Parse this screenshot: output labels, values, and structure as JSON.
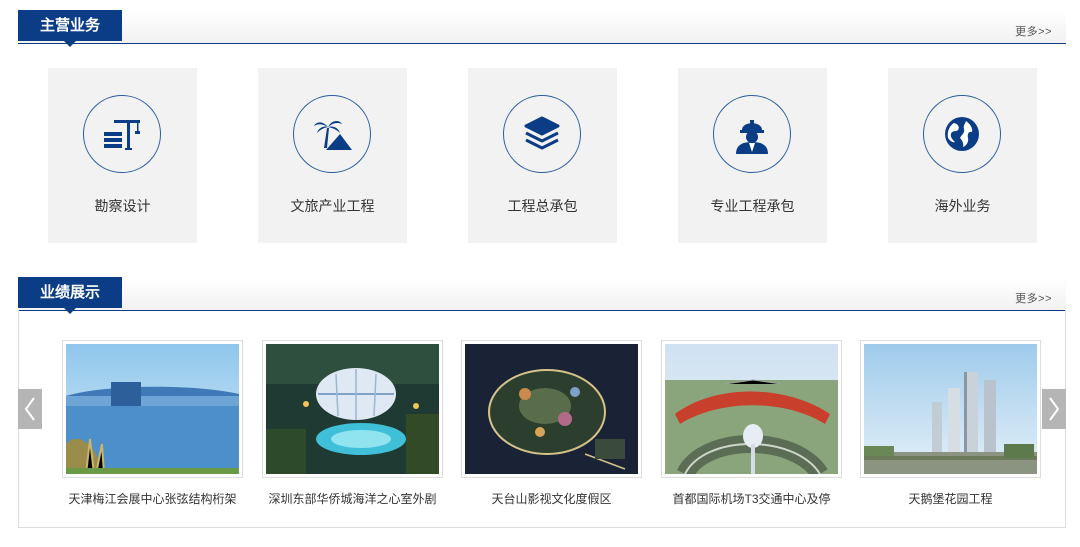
{
  "sections": {
    "services": {
      "title": "主营业务",
      "more": "更多>>"
    },
    "works": {
      "title": "业绩展示",
      "more": "更多>>"
    }
  },
  "services": [
    {
      "label": "勘察设计",
      "icon": "crane-building-icon"
    },
    {
      "label": "文旅产业工程",
      "icon": "palm-mountain-icon"
    },
    {
      "label": "工程总承包",
      "icon": "layers-icon"
    },
    {
      "label": "专业工程承包",
      "icon": "worker-hardhat-icon"
    },
    {
      "label": "海外业务",
      "icon": "globe-icon"
    }
  ],
  "works": [
    {
      "caption": "天津梅江会展中心张弦结构桁架"
    },
    {
      "caption": "深圳东部华侨城海洋之心室外剧"
    },
    {
      "caption": "天台山影视文化度假区"
    },
    {
      "caption": "首都国际机场T3交通中心及停"
    },
    {
      "caption": "天鹅堡花园工程"
    }
  ],
  "colors": {
    "accent": "#0b3d86",
    "card_bg": "#f2f2f2",
    "arrow_bg": "#b5b5b5"
  }
}
